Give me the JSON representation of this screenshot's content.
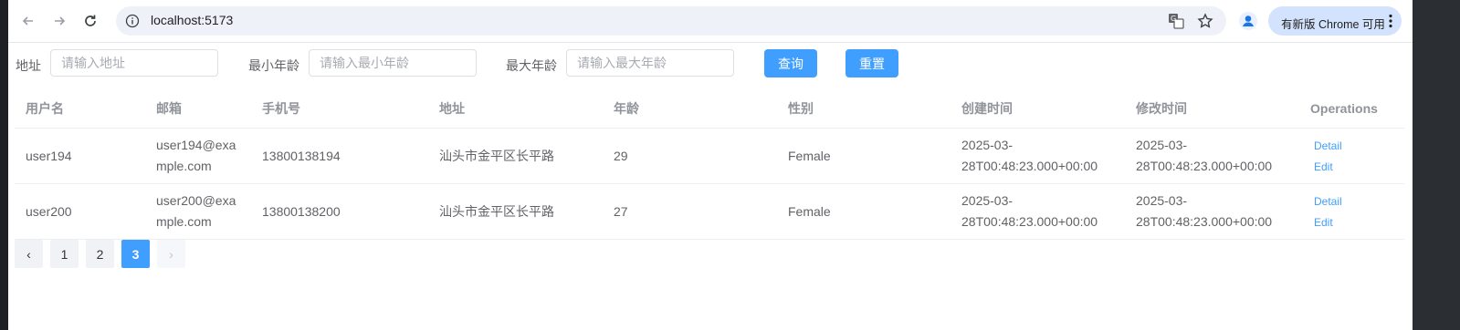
{
  "browser": {
    "url": "localhost:5173",
    "update_label": "有新版 Chrome 可用"
  },
  "filters": {
    "address_label": "地址",
    "address_placeholder": "请输入地址",
    "min_age_label": "最小年龄",
    "min_age_placeholder": "请输入最小年龄",
    "max_age_label": "最大年龄",
    "max_age_placeholder": "请输入最大年龄",
    "query_label": "查询",
    "reset_label": "重置"
  },
  "table": {
    "headers": [
      "用户名",
      "邮箱",
      "手机号",
      "地址",
      "年龄",
      "性别",
      "创建时间",
      "修改时间",
      "Operations"
    ],
    "rows": [
      {
        "username": "user194",
        "email": "user194@example.com",
        "phone": "13800138194",
        "address": "汕头市金平区长平路",
        "age": "29",
        "gender": "Female",
        "created": "2025-03-28T00:48:23.000+00:00",
        "modified": "2025-03-28T00:48:23.000+00:00"
      },
      {
        "username": "user200",
        "email": "user200@example.com",
        "phone": "13800138200",
        "address": "汕头市金平区长平路",
        "age": "27",
        "gender": "Female",
        "created": "2025-03-28T00:48:23.000+00:00",
        "modified": "2025-03-28T00:48:23.000+00:00"
      }
    ],
    "detail_label": "Detail",
    "edit_label": "Edit"
  },
  "pagination": {
    "pages": [
      "1",
      "2",
      "3"
    ],
    "current": "3",
    "prev": "‹",
    "next": "›"
  },
  "colors": {
    "primary": "#409eff",
    "header_text": "#909399"
  }
}
